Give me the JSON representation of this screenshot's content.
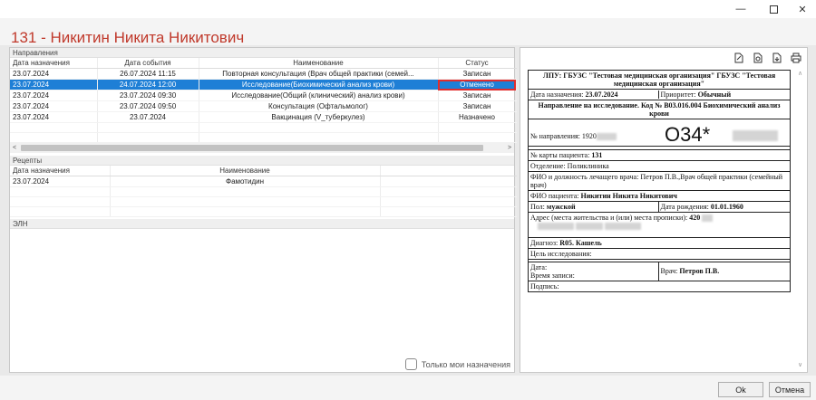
{
  "window": {
    "minimize": "—",
    "close": "✕"
  },
  "header": {
    "title": "131 - Никитин Никита Никитович"
  },
  "referrals": {
    "section_title": "Направления",
    "columns": [
      "Дата назначения",
      "Дата события",
      "Наименование",
      "Статус"
    ],
    "rows": [
      [
        "23.07.2024",
        "26.07.2024 11:15",
        "Повторная консультация (Врач общей практики (семей...",
        "Записан"
      ],
      [
        "23.07.2024",
        "24.07.2024 12:00",
        "Исследование(Биохимический анализ крови)",
        "Отменено"
      ],
      [
        "23.07.2024",
        "23.07.2024 09:30",
        "Исследование(Общий (клинический) анализ крови)",
        "Записан"
      ],
      [
        "23.07.2024",
        "23.07.2024 09:50",
        "Консультация (Офтальмолог)",
        "Записан"
      ],
      [
        "23.07.2024",
        "23.07.2024",
        "Вакцинация (V_туберкулез)",
        "Назначено"
      ]
    ]
  },
  "recipes": {
    "section_title": "Рецепты",
    "columns": [
      "Дата назначения",
      "Наименование"
    ],
    "rows": [
      [
        "23.07.2024",
        "Фамотидин"
      ]
    ]
  },
  "eln": {
    "section_title": "ЭЛН"
  },
  "only_mine_label": "Только мои назначения",
  "document": {
    "org": "ЛПУ: ГБУЗС \"Тестовая медицинская организация\" ГБУЗС \"Тестовая медицинская организация\"",
    "date_label": "Дата назначения: ",
    "date_value": "23.07.2024",
    "priority_label": "Приоритет: ",
    "priority_value": "Обычный",
    "title": "Направление на исследование. Код № B03.016.004 Биохимический анализ крови",
    "referral_num_label": "№ направления: 1920",
    "code": "O34*",
    "card_label": "№ карты пациента: ",
    "card_value": "131",
    "department": "Отделение: Поликлиника",
    "doctor_fio": "ФИО и должность лечащего врача: Петров П.В.,Врач общей практики (семейный врач)",
    "patient_label": "ФИО пациента: ",
    "patient_value": "Никитин Никита Никитович",
    "sex_label": "Пол: ",
    "sex_value": "мужской",
    "birth_label": "Дата рождения: ",
    "birth_value": "01.01.1960",
    "address_label": "Адрес (места жительства и (или) места прописки): ",
    "address_value": "420",
    "diagnosis_label": "Диагноз: ",
    "diagnosis_value": "R05. Кашель",
    "purpose": "Цель исследования:",
    "date_field": "Дата:",
    "time_field": "Время записи:",
    "doctor_label": "Врач: ",
    "doctor_value": "Петров П.В.",
    "signature": "Подпись:"
  },
  "footer": {
    "ok": "Ok",
    "cancel": "Отмена"
  }
}
